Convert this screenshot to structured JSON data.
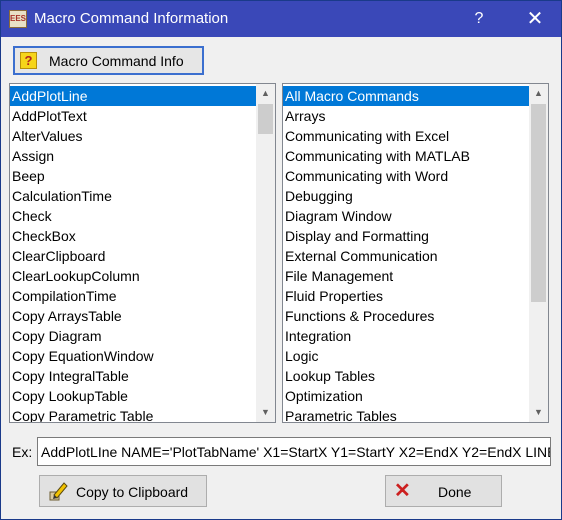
{
  "window": {
    "title": "Macro Command Information",
    "app_icon_text": "EES",
    "help_label": "?",
    "close_label": "✕"
  },
  "toolbar": {
    "info_button_label": "Macro Command Info",
    "info_icon": "?"
  },
  "commands": [
    "AddPlotLine",
    "AddPlotText",
    "AlterValues",
    "Assign",
    "Beep",
    "CalculationTime",
    "Check",
    "CheckBox",
    "ClearClipboard",
    "ClearLookupColumn",
    "CompilationTime",
    "Copy ArraysTable",
    "Copy Diagram",
    "Copy EquationWindow",
    "Copy IntegralTable",
    "Copy LookupTable",
    "Copy Parametric Table"
  ],
  "categories": [
    "All Macro Commands",
    "Arrays",
    "Communicating with Excel",
    "Communicating with MATLAB",
    "Communicating with Word",
    "Debugging",
    "Diagram Window",
    "Display and Formatting",
    "External Communication",
    "File Management",
    "Fluid Properties",
    "Functions & Procedures",
    "Integration",
    "Logic",
    "Lookup Tables",
    "Optimization",
    "Parametric Tables"
  ],
  "example": {
    "label": "Ex:",
    "text": "AddPlotLIne NAME='PlotTabName' X1=StartX Y1=StartY X2=EndX Y2=EndX LINE"
  },
  "buttons": {
    "copy_label": "Copy to Clipboard",
    "done_label": "Done",
    "done_icon": "✕"
  },
  "colors": {
    "titlebar": "#3a48b8",
    "selection": "#0078d7"
  }
}
